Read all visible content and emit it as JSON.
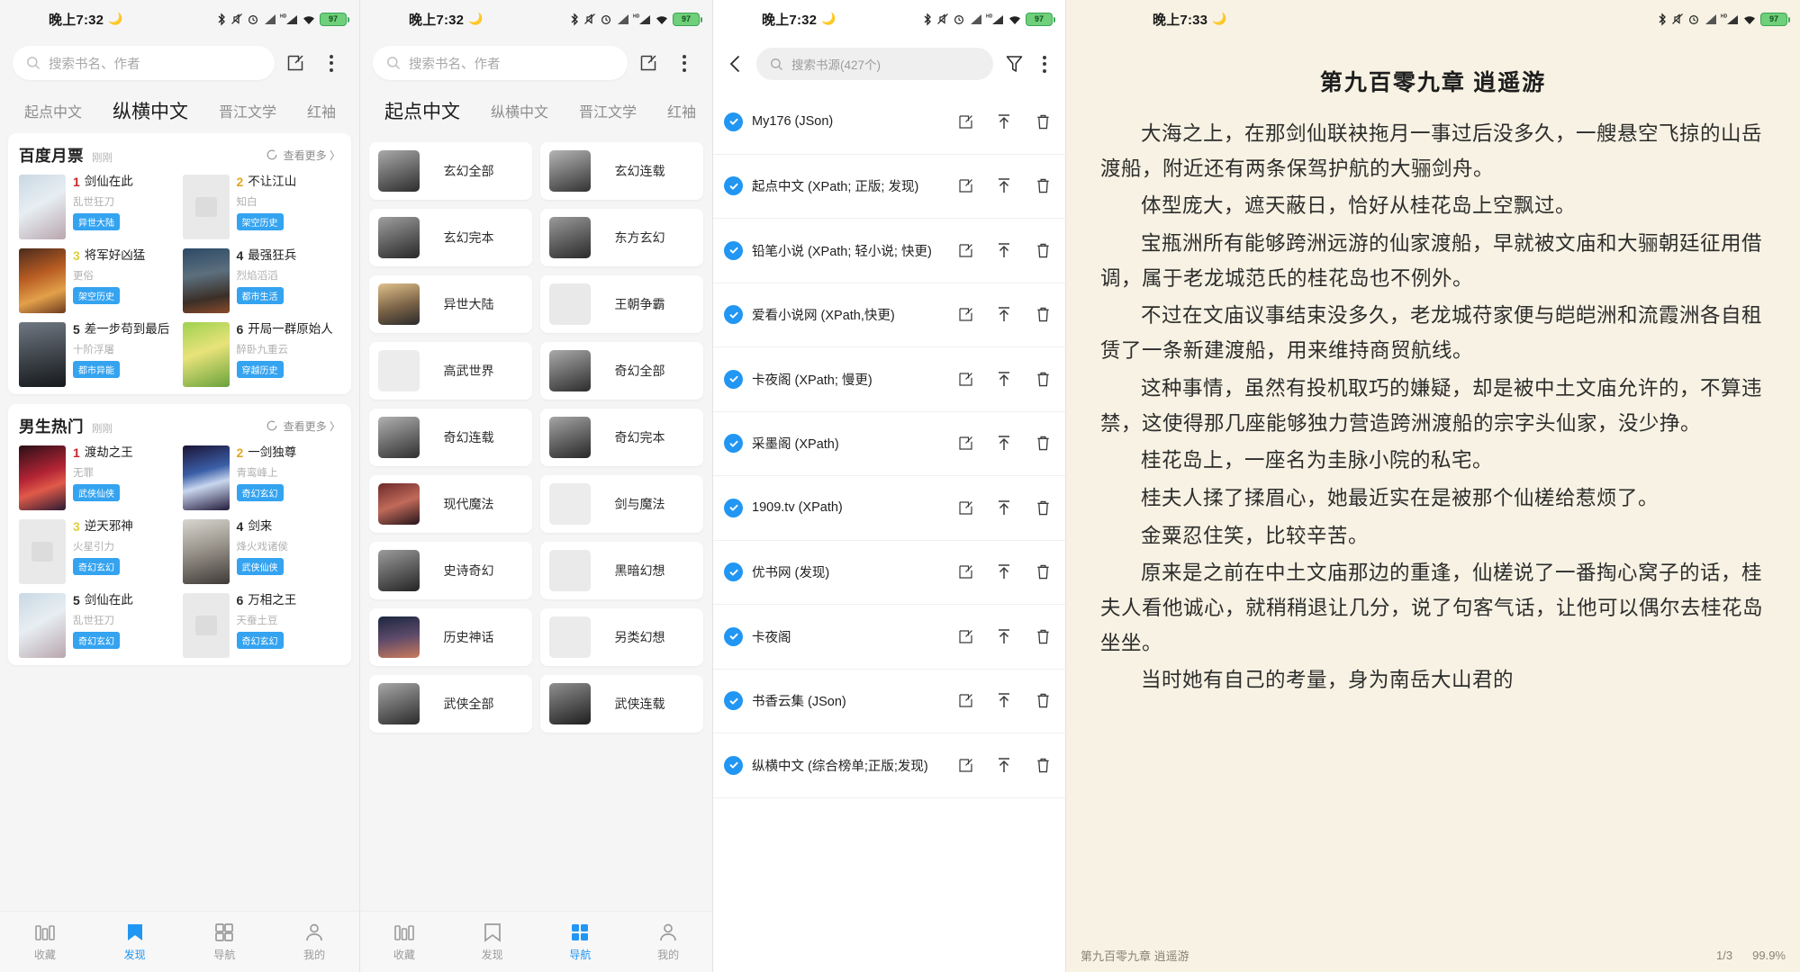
{
  "panels": {
    "discover": {
      "status": {
        "time": "晚上7:32",
        "moon_icon": "moon-icon",
        "battery": "97"
      },
      "search": {
        "placeholder": "搜索书名、作者",
        "search_icon": "search-icon"
      },
      "toolbar": {
        "edit_icon": "edit-square-icon",
        "overflow_icon": "more-vertical-icon"
      },
      "source_tabs": [
        {
          "label": "起点中文",
          "active": false
        },
        {
          "label": "纵横中文",
          "active": true
        },
        {
          "label": "晋江文学",
          "active": false
        },
        {
          "label": "红袖",
          "active": false
        }
      ],
      "sections": [
        {
          "title": "百度月票",
          "subtitle": "刚刚",
          "more_label": "查看更多 〉",
          "refresh_icon": "refresh-icon",
          "books": [
            {
              "rank": "1",
              "name": "剑仙在此",
              "author": "乱世狂刀",
              "tag": "异世大陆",
              "cover": "art"
            },
            {
              "rank": "2",
              "name": "不让江山",
              "author": "知白",
              "tag": "架空历史",
              "cover": "placeholder"
            },
            {
              "rank": "3",
              "name": "将军好凶猛",
              "author": "更俗",
              "tag": "架空历史",
              "cover": "art"
            },
            {
              "rank": "4",
              "name": "最强狂兵",
              "author": "烈焰滔滔",
              "tag": "都市生活",
              "cover": "art"
            },
            {
              "rank": "5",
              "name": "差一步苟到最后",
              "author": "十阶浮屠",
              "tag": "都市异能",
              "cover": "art"
            },
            {
              "rank": "6",
              "name": "开局一群原始人",
              "author": "醉卧九重云",
              "tag": "穿越历史",
              "cover": "art"
            }
          ]
        },
        {
          "title": "男生热门",
          "subtitle": "刚刚",
          "more_label": "查看更多 〉",
          "refresh_icon": "refresh-icon",
          "books": [
            {
              "rank": "1",
              "name": "渡劫之王",
              "author": "无罪",
              "tag": "武侠仙侠",
              "cover": "art"
            },
            {
              "rank": "2",
              "name": "一剑独尊",
              "author": "青鸾峰上",
              "tag": "奇幻玄幻",
              "cover": "art"
            },
            {
              "rank": "3",
              "name": "逆天邪神",
              "author": "火星引力",
              "tag": "奇幻玄幻",
              "cover": "placeholder"
            },
            {
              "rank": "4",
              "name": "剑来",
              "author": "烽火戏诸侯",
              "tag": "武侠仙侠",
              "cover": "art"
            },
            {
              "rank": "5",
              "name": "剑仙在此",
              "author": "乱世狂刀",
              "tag": "奇幻玄幻",
              "cover": "art"
            },
            {
              "rank": "6",
              "name": "万相之王",
              "author": "天蚕土豆",
              "tag": "奇幻玄幻",
              "cover": "placeholder"
            }
          ]
        }
      ],
      "bottom_nav": [
        {
          "label": "收藏",
          "icon": "bookshelf-icon",
          "active": false
        },
        {
          "label": "发现",
          "icon": "discover-icon",
          "active": true
        },
        {
          "label": "导航",
          "icon": "grid-icon",
          "active": false
        },
        {
          "label": "我的",
          "icon": "person-icon",
          "active": false
        }
      ]
    },
    "categories": {
      "status": {
        "time": "晚上7:32",
        "moon_icon": "moon-icon",
        "battery": "97"
      },
      "search": {
        "placeholder": "搜索书名、作者",
        "search_icon": "search-icon"
      },
      "toolbar": {
        "edit_icon": "edit-square-icon",
        "overflow_icon": "more-vertical-icon"
      },
      "source_tabs": [
        {
          "label": "起点中文",
          "active": true
        },
        {
          "label": "纵横中文",
          "active": false
        },
        {
          "label": "晋江文学",
          "active": false
        },
        {
          "label": "红袖",
          "active": false
        }
      ],
      "items": [
        {
          "label": "玄幻全部",
          "thumb": "art"
        },
        {
          "label": "玄幻连载",
          "thumb": "art"
        },
        {
          "label": "玄幻完本",
          "thumb": "art"
        },
        {
          "label": "东方玄幻",
          "thumb": "art"
        },
        {
          "label": "异世大陆",
          "thumb": "art"
        },
        {
          "label": "王朝争霸",
          "thumb": "placeholder"
        },
        {
          "label": "高武世界",
          "thumb": "placeholder"
        },
        {
          "label": "奇幻全部",
          "thumb": "art"
        },
        {
          "label": "奇幻连载",
          "thumb": "art"
        },
        {
          "label": "奇幻完本",
          "thumb": "art"
        },
        {
          "label": "现代魔法",
          "thumb": "art"
        },
        {
          "label": "剑与魔法",
          "thumb": "placeholder"
        },
        {
          "label": "史诗奇幻",
          "thumb": "art"
        },
        {
          "label": "黑暗幻想",
          "thumb": "placeholder"
        },
        {
          "label": "历史神话",
          "thumb": "art"
        },
        {
          "label": "另类幻想",
          "thumb": "placeholder"
        },
        {
          "label": "武侠全部",
          "thumb": "art"
        },
        {
          "label": "武侠连载",
          "thumb": "art"
        }
      ],
      "bottom_nav": [
        {
          "label": "收藏",
          "icon": "bookshelf-icon",
          "active": false
        },
        {
          "label": "发现",
          "icon": "discover-icon",
          "active": false
        },
        {
          "label": "导航",
          "icon": "grid-icon",
          "active": true
        },
        {
          "label": "我的",
          "icon": "person-icon",
          "active": false
        }
      ]
    },
    "book_sources": {
      "status": {
        "time": "晚上7:32",
        "moon_icon": "moon-icon",
        "battery": "97"
      },
      "header": {
        "back_icon": "chevron-left-icon",
        "search_placeholder": "搜索书源(427个)",
        "search_icon": "search-icon",
        "filter_icon": "filter-icon",
        "overflow_icon": "more-vertical-icon"
      },
      "row_actions": {
        "edit_icon": "edit-square-icon",
        "top_icon": "move-to-top-icon",
        "delete_icon": "trash-icon"
      },
      "sources": [
        {
          "name": "My176 (JSon)",
          "enabled": true
        },
        {
          "name": "起点中文 (XPath; 正版; 发现)",
          "enabled": true
        },
        {
          "name": "铅笔小说 (XPath; 轻小说; 快更)",
          "enabled": true
        },
        {
          "name": "爱看小说网 (XPath,快更)",
          "enabled": true
        },
        {
          "name": "卡夜阁 (XPath; 慢更)",
          "enabled": true
        },
        {
          "name": "采墨阁 (XPath)",
          "enabled": true
        },
        {
          "name": "1909.tv (XPath)",
          "enabled": true
        },
        {
          "name": "优书网 (发现)",
          "enabled": true
        },
        {
          "name": "卡夜阁",
          "enabled": true
        },
        {
          "name": "书香云集 (JSon)",
          "enabled": true
        },
        {
          "name": "纵横中文 (综合榜单;正版;发现)",
          "enabled": true
        }
      ]
    },
    "reader": {
      "status": {
        "time": "晚上7:33",
        "moon_icon": "moon-icon",
        "battery": "97"
      },
      "chapter_title": "第九百零九章 逍遥游",
      "paragraphs": [
        "大海之上，在那剑仙联袂拖月一事过后没多久，一艘悬空飞掠的山岳渡船，附近还有两条保驾护航的大骊剑舟。",
        "体型庞大，遮天蔽日，恰好从桂花岛上空飘过。",
        "宝瓶洲所有能够跨洲远游的仙家渡船，早就被文庙和大骊朝廷征用借调，属于老龙城范氏的桂花岛也不例外。",
        "不过在文庙议事结束没多久，老龙城苻家便与皑皑洲和流霞洲各自租赁了一条新建渡船，用来维持商贸航线。",
        "这种事情，虽然有投机取巧的嫌疑，却是被中土文庙允许的，不算违禁，这使得那几座能够独力营造跨洲渡船的宗字头仙家，没少挣。",
        "桂花岛上，一座名为圭脉小院的私宅。",
        "桂夫人揉了揉眉心，她最近实在是被那个仙槎给惹烦了。",
        "金粟忍住笑，比较辛苦。",
        "原来是之前在中土文庙那边的重逢，仙槎说了一番掏心窝子的话，桂夫人看他诚心，就稍稍退让几分，说了句客气话，让他可以偶尔去桂花岛坐坐。",
        "当时她有自己的考量，身为南岳大山君的"
      ],
      "footer": {
        "chapter": "第九百零九章 逍遥游",
        "page": "1/3",
        "battery_percent": "99.9%"
      }
    }
  },
  "colors": {
    "accent": "#2196f3",
    "tag": "#34a3f0",
    "rank1": "#c6272b",
    "rank2": "#e0a722",
    "rank3": "#ddd040",
    "reader_bg": "#f7f2e3",
    "battery_green": "#6fcf7a"
  }
}
